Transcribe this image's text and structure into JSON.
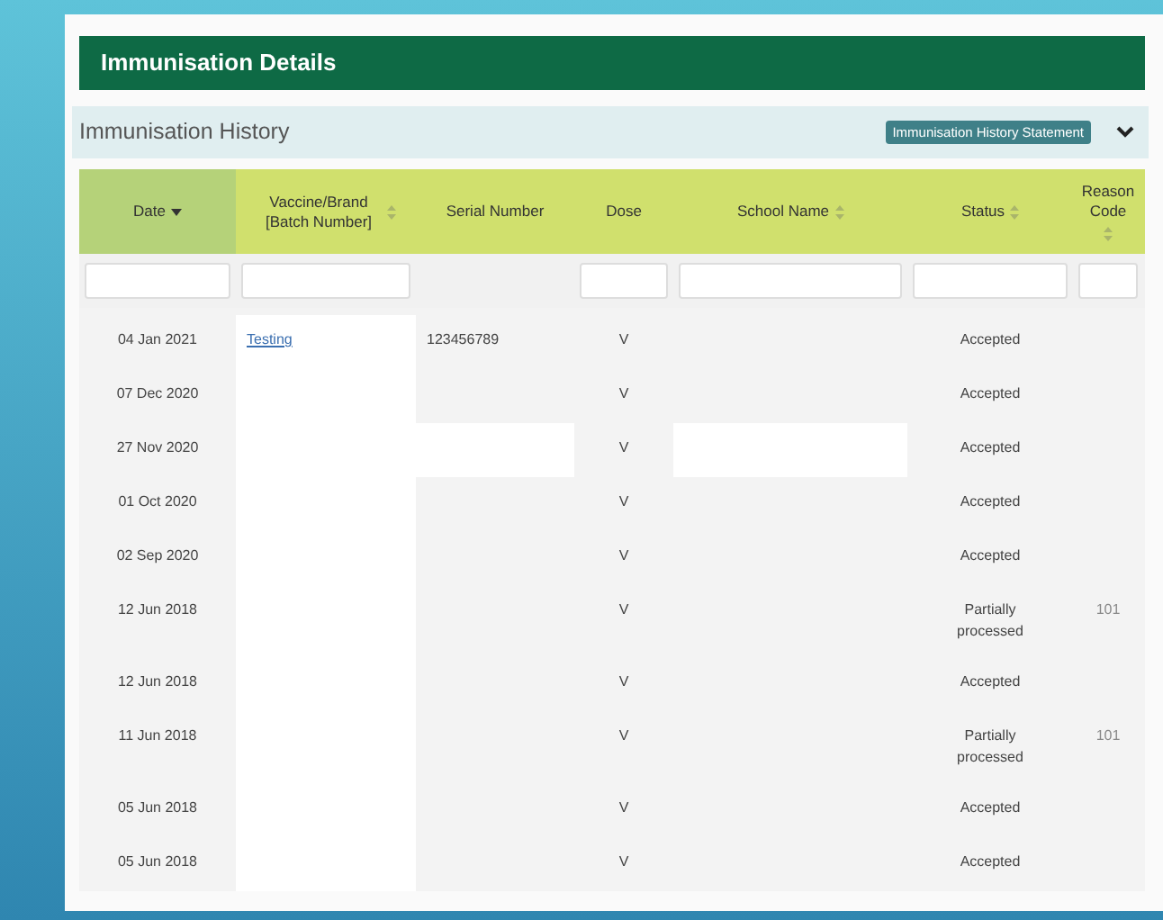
{
  "panel_title": "Immunisation Details",
  "section": {
    "title": "Immunisation History",
    "button": "Immunisation History Statement",
    "expanded": true
  },
  "columns": [
    {
      "label": "Date",
      "sortable": true,
      "sorted": true,
      "filter": true
    },
    {
      "label": "Vaccine/Brand [Batch Number]",
      "sortable": true,
      "sorted": false,
      "filter": true
    },
    {
      "label": "Serial Number",
      "sortable": false,
      "sorted": false,
      "filter": false
    },
    {
      "label": "Dose",
      "sortable": false,
      "sorted": false,
      "filter": true
    },
    {
      "label": "School Name",
      "sortable": true,
      "sorted": false,
      "filter": true
    },
    {
      "label": "Status",
      "sortable": true,
      "sorted": false,
      "filter": true
    },
    {
      "label": "Reason Code",
      "sortable": true,
      "sorted": false,
      "filter": true
    }
  ],
  "rows": [
    {
      "date": "04 Jan 2021",
      "vaccine": "Testing",
      "serial": "123456789",
      "dose": "V",
      "status": "Accepted",
      "vaccine_hidden": true
    },
    {
      "date": "07 Dec 2020",
      "dose": "V",
      "status": "Accepted",
      "vaccine_hidden": true
    },
    {
      "date": "27 Nov 2020",
      "dose": "V",
      "status": "Accepted",
      "vaccine_hidden": true,
      "serial_hidden": true,
      "school_hidden": true
    },
    {
      "date": "01 Oct 2020",
      "dose": "V",
      "status": "Accepted",
      "vaccine_hidden": true
    },
    {
      "date": "02 Sep 2020",
      "dose": "V",
      "status": "Accepted",
      "vaccine_hidden": true
    },
    {
      "date": "12 Jun 2018",
      "dose": "V",
      "status": "Partially processed",
      "reason": "101",
      "vaccine_hidden": true
    },
    {
      "date": "12 Jun 2018",
      "dose": "V",
      "status": "Accepted",
      "vaccine_hidden": true
    },
    {
      "date": "11 Jun 2018",
      "dose": "V",
      "status": "Partially processed",
      "reason": "101",
      "vaccine_hidden": true
    },
    {
      "date": "05 Jun 2018",
      "dose": "V",
      "status": "Accepted",
      "vaccine_hidden": true
    },
    {
      "date": "05 Jun 2018",
      "dose": "V",
      "status": "Accepted",
      "vaccine_hidden": true
    }
  ]
}
